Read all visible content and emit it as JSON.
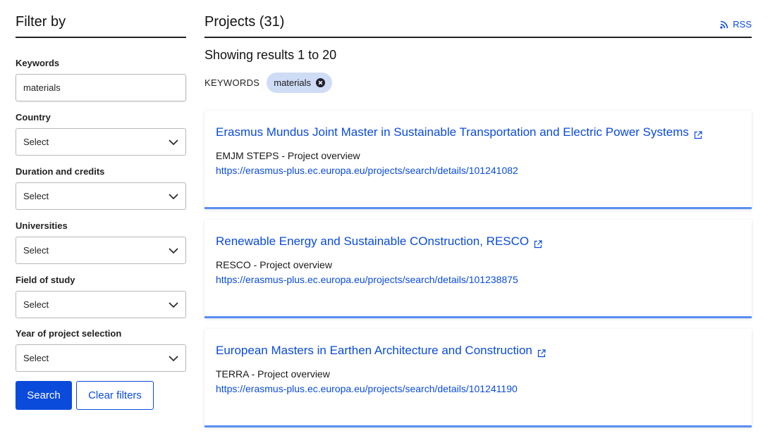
{
  "sidebar": {
    "title": "Filter by",
    "keywords": {
      "label": "Keywords",
      "value": "materials"
    },
    "filters": [
      {
        "label": "Country",
        "selected": "Select"
      },
      {
        "label": "Duration and credits",
        "selected": "Select"
      },
      {
        "label": "Universities",
        "selected": "Select"
      },
      {
        "label": "Field of study",
        "selected": "Select"
      },
      {
        "label": "Year of project selection",
        "selected": "Select"
      }
    ],
    "search_label": "Search",
    "clear_label": "Clear filters"
  },
  "main": {
    "title": "Projects (31)",
    "rss_label": "RSS",
    "results_text": "Showing results 1 to 20",
    "active_filter_label": "KEYWORDS",
    "active_filter_chip": "materials",
    "projects": [
      {
        "title": "Erasmus Mundus Joint Master in Sustainable Transportation and Electric Power Systems",
        "subtitle": "EMJM STEPS - Project overview",
        "url": "https://erasmus-plus.ec.europa.eu/projects/search/details/101241082"
      },
      {
        "title": "Renewable Energy and Sustainable COnstruction, RESCO",
        "subtitle": "RESCO - Project overview",
        "url": "https://erasmus-plus.ec.europa.eu/projects/search/details/101238875"
      },
      {
        "title": "European Masters in Earthen Architecture and Construction",
        "subtitle": "TERRA - Project overview",
        "url": "https://erasmus-plus.ec.europa.eu/projects/search/details/101241190"
      }
    ]
  },
  "colors": {
    "accent": "#0a4bdc",
    "card_border": "#5a8ef2",
    "chip_bg": "#cfdcf6"
  }
}
